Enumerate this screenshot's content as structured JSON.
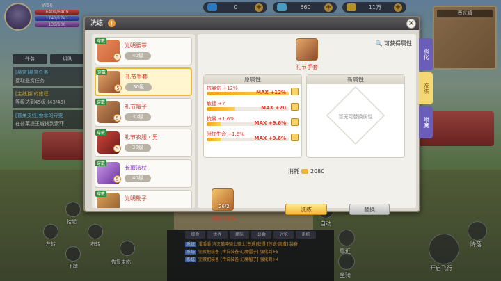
{
  "player": {
    "name": "W56",
    "level": "...",
    "hp": "6409/6409",
    "mp": "1741/1741",
    "exp": "135/100"
  },
  "currencies": [
    {
      "icon": "diamond-icon",
      "color": "#3aa0ff",
      "value": "0"
    },
    {
      "icon": "bound-diamond-icon",
      "color": "#5fd0ff",
      "value": "660"
    },
    {
      "icon": "gold-icon",
      "color": "#f0c03a",
      "value": "11万"
    }
  ],
  "minimap": {
    "title": "晋光镇"
  },
  "quest_panel": {
    "tabs": [
      "任务",
      "组队"
    ],
    "quests": [
      {
        "title": "[悬赏]悬赏任务",
        "desc": "接取悬赏任务"
      },
      {
        "title": "[主线]新的旅程",
        "desc": "等级达到45级 (43/45)"
      },
      {
        "title": "[普莱支线]索菲的异变",
        "desc": "在普莱提王城找到索菲"
      }
    ]
  },
  "controls": {
    "pickup": "拾起",
    "left": "左转",
    "right": "右转",
    "down": "下蹲",
    "restore": "恢复来临",
    "auto": "自动",
    "dock": "靠近",
    "mount": "坐骑",
    "fly": "开启飞行",
    "descend": "降落"
  },
  "chat": {
    "tabs": [
      "综合",
      "世界",
      "组队",
      "公会",
      "讨论",
      "系统"
    ],
    "system_label": "系统",
    "lines": [
      "潘潘潘 消灭猫冲骑士骑士(普通)获得 [传说·凯撒] 装备",
      "完蛋把装备 [传说装备·幻魔帽子] 强化到+5",
      "完蛋把装备 [传说装备·幻魔帽子] 强化到+4"
    ]
  },
  "dialog": {
    "title": "洗练",
    "info_icon": "!",
    "close": "×",
    "vertical_tabs": [
      "强化",
      "洗练",
      "附魔"
    ],
    "active_tab": 1,
    "items": [
      {
        "name": "光明腰带",
        "level": "40级",
        "badge": "穿戴",
        "lv": "5",
        "color": "#c9643a"
      },
      {
        "name": "礼节手套",
        "level": "30级",
        "badge": "穿戴",
        "lv": "5",
        "color": "#b56a3a"
      },
      {
        "name": "礼节帽子",
        "level": "30级",
        "badge": "穿戴",
        "lv": "5",
        "color": "#9a5a36"
      },
      {
        "name": "礼节衣服・男",
        "level": "30级",
        "badge": "穿戴",
        "lv": "5",
        "color": "#a3302a"
      },
      {
        "name": "长蘑法杖",
        "level": "40级",
        "badge": "穿戴",
        "lv": "5",
        "color": "#8a3fcf"
      },
      {
        "name": "光明靴子",
        "level": "",
        "badge": "穿戴",
        "lv": "5",
        "color": "#c0703a"
      }
    ],
    "selected_index": 1,
    "main": {
      "attr_link": "可获得属性",
      "preview_name": "礼节手套",
      "original_header": "原属性",
      "new_header": "新属性",
      "empty_text": "暂无可替换属性",
      "attributes": [
        {
          "name": "抗暴伤 +12%",
          "max": "MAX +12%",
          "progress": 1.0
        },
        {
          "name": "敏捷 +7",
          "max": "MAX +20",
          "progress": 0.35
        },
        {
          "name": "抗暴 +1.6%",
          "max": "MAX +9.6%",
          "progress": 0.17
        },
        {
          "name": "附加生命 +1.6%",
          "max": "MAX +9.6%",
          "progress": 0.17
        }
      ],
      "cost_label": "消耗",
      "cost_value": "2080",
      "stone_name": "橙色洗练石",
      "stone_count": "26/2",
      "wash_button": "洗练",
      "replace_button": "替换"
    }
  }
}
